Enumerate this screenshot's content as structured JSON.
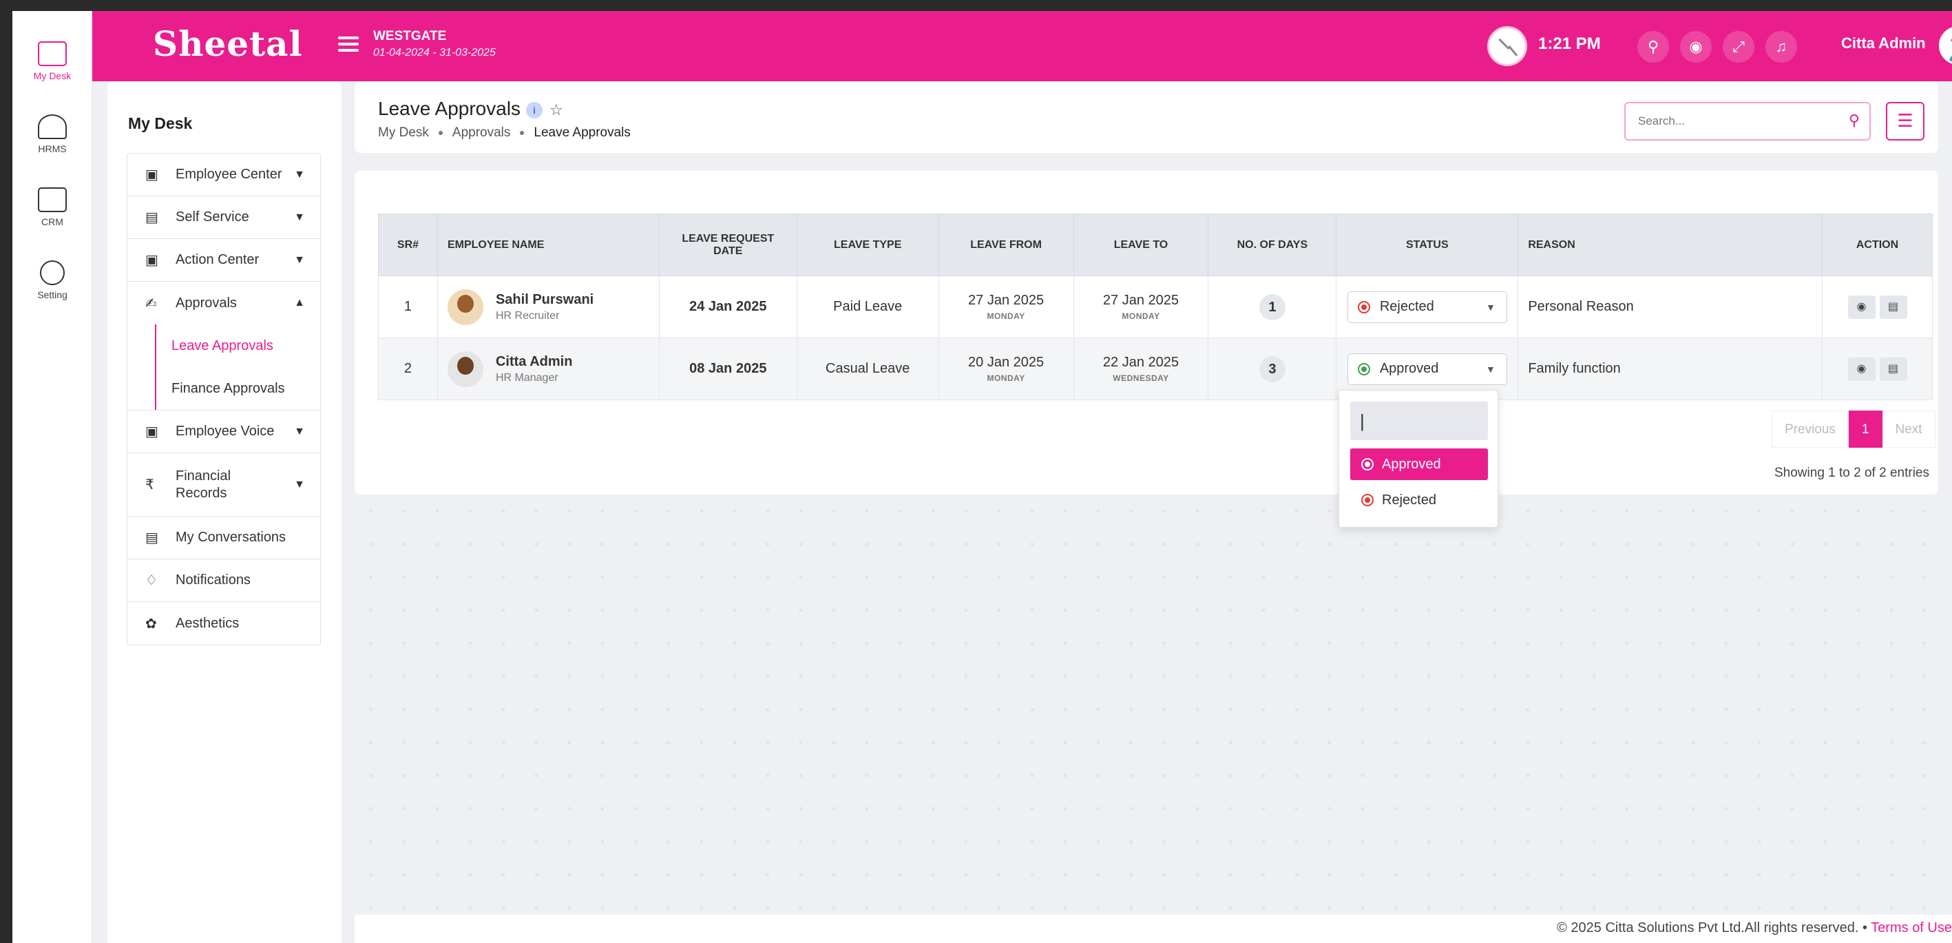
{
  "app": {
    "brand": "Sheetal",
    "org_name": "WESTGATE",
    "org_dates": "01-04-2024 - 31-03-2025",
    "time": "1:21 PM",
    "user_name": "Citta Admin",
    "accent_color": "#e91e8c"
  },
  "rail": [
    {
      "label": "My Desk",
      "icon": "desk-icon"
    },
    {
      "label": "HRMS",
      "icon": "hrms-icon"
    },
    {
      "label": "CRM",
      "icon": "crm-icon"
    },
    {
      "label": "Setting",
      "icon": "settings-icon"
    }
  ],
  "sidemenu": {
    "title": "My Desk",
    "items": [
      {
        "label": "Employee Center"
      },
      {
        "label": "Self Service"
      },
      {
        "label": "Action Center"
      },
      {
        "label": "Approvals"
      },
      {
        "label": "Leave Approvals"
      },
      {
        "label": "Finance Approvals"
      },
      {
        "label": "Employee Voice"
      },
      {
        "label": "Financial Records"
      },
      {
        "label": "My Conversations"
      },
      {
        "label": "Notifications"
      },
      {
        "label": "Aesthetics"
      }
    ]
  },
  "header": {
    "title": "Leave Approvals",
    "info_badge": "i",
    "breadcrumb": [
      "My Desk",
      "Approvals",
      "Leave Approvals"
    ],
    "search_placeholder": "Search..."
  },
  "table": {
    "columns": [
      "SR#",
      "EMPLOYEE NAME",
      "LEAVE REQUEST DATE",
      "LEAVE TYPE",
      "LEAVE FROM",
      "LEAVE TO",
      "NO. OF DAYS",
      "STATUS",
      "REASON",
      "ACTION"
    ],
    "rows": [
      {
        "sr": "1",
        "name": "Sahil Purswani",
        "role": "HR Recruiter",
        "request_date": "24 Jan 2025",
        "type": "Paid Leave",
        "from": "27 Jan 2025",
        "from_day": "MONDAY",
        "to": "27 Jan 2025",
        "to_day": "MONDAY",
        "days": "1",
        "status": "Rejected",
        "reason": "Personal Reason"
      },
      {
        "sr": "2",
        "name": "Citta Admin",
        "role": "HR Manager",
        "request_date": "08 Jan 2025",
        "type": "Casual Leave",
        "from": "20 Jan 2025",
        "from_day": "MONDAY",
        "to": "22 Jan 2025",
        "to_day": "WEDNESDAY",
        "days": "3",
        "status": "Approved",
        "reason": "Family function"
      }
    ]
  },
  "dropdown": {
    "options": [
      "Approved",
      "Rejected"
    ],
    "selected": "Approved"
  },
  "pagination": {
    "previous": "Previous",
    "current": "1",
    "next": "Next",
    "summary": "Showing 1 to 2 of 2 entries"
  },
  "footer": {
    "copyright": "© 2025 Citta Solutions Pvt Ltd.All rights reserved.",
    "terms": "Terms of Use"
  }
}
